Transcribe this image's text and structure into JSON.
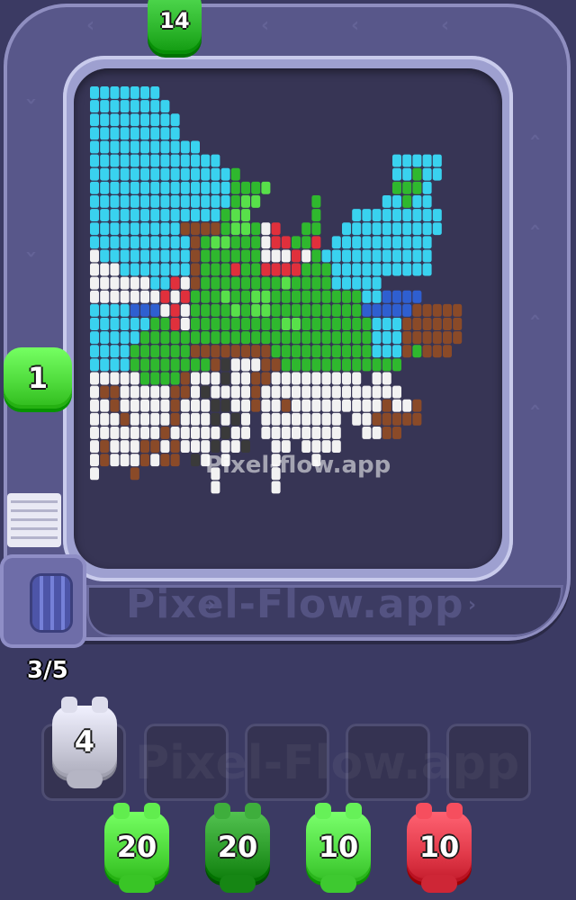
{
  "watermarks": {
    "track": "Pixel-Flow.app",
    "board": "Pixel-flow.app",
    "slots": "Pixel-Flow.app"
  },
  "shooters_on_track": [
    {
      "count": "14",
      "color": "#2fb82e"
    },
    {
      "count": "1",
      "color": "#4dd93a"
    }
  ],
  "queue_counter": "3/5",
  "slot_shooters": [
    {
      "count": "4",
      "color": "#c9c9d8"
    }
  ],
  "bottom_shooters": [
    {
      "count": "20",
      "color": "#4dd93a"
    },
    {
      "count": "20",
      "color": "#2a9a28"
    },
    {
      "count": "10",
      "color": "#52dd44"
    },
    {
      "count": "10",
      "color": "#e23a4a"
    }
  ],
  "palette": {
    "sky": "#39d2ef",
    "snow": "#f2f2f2",
    "green": "#2fb82e",
    "light_green": "#58e04a",
    "red": "#e0303c",
    "brown": "#8a4a28",
    "blue": "#2f5fd0",
    "dark": "#3a3a3a"
  }
}
